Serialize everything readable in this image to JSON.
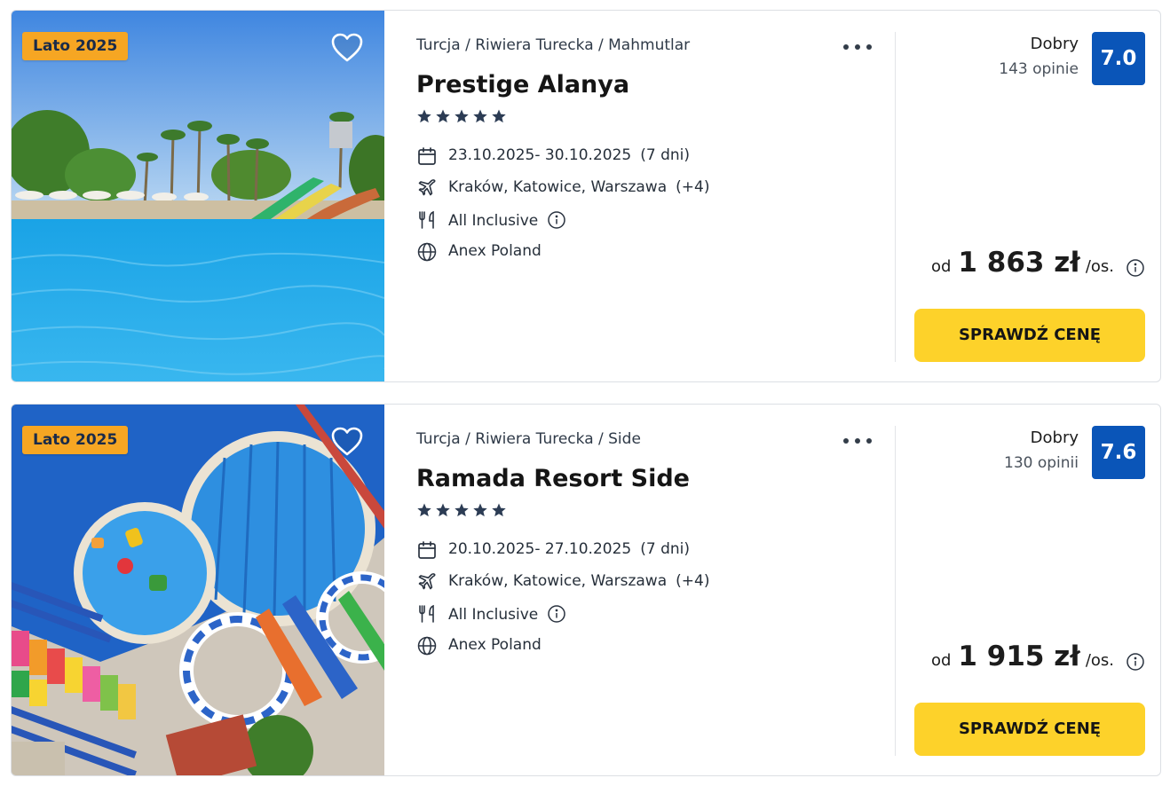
{
  "offers": [
    {
      "badge": "Lato 2025",
      "breadcrumb": "Turcja / Riwiera Turecka / Mahmutlar",
      "name": "Prestige Alanya",
      "stars": 5,
      "dates": "23.10.2025- 30.10.2025",
      "duration": "(7 dni)",
      "airports": "Kraków, Katowice, Warszawa",
      "airports_more": "(+4)",
      "board": "All Inclusive",
      "operator": "Anex Poland",
      "rating_label": "Dobry",
      "rating_count": "143 opinie",
      "rating_score": "7.0",
      "price_from": "od",
      "price": "1 863 zł",
      "price_unit": "/os.",
      "cta": "SPRAWDŹ CENĘ",
      "photo": "resort-pool-with-waterslides"
    },
    {
      "badge": "Lato 2025",
      "breadcrumb": "Turcja / Riwiera Turecka / Side",
      "name": "Ramada Resort Side",
      "stars": 5,
      "dates": "20.10.2025- 27.10.2025",
      "duration": "(7 dni)",
      "airports": "Kraków, Katowice, Warszawa",
      "airports_more": "(+4)",
      "board": "All Inclusive",
      "operator": "Anex Poland",
      "rating_label": "Dobry",
      "rating_count": "130 opinii",
      "rating_score": "7.6",
      "price_from": "od",
      "price": "1 915 zł",
      "price_unit": "/os.",
      "cta": "SPRAWDŹ CENĘ",
      "photo": "aerial-aquapark-pools"
    }
  ],
  "colors": {
    "badge": "#f6a623",
    "score": "#0a55b8",
    "cta": "#fdd22a",
    "star": "#2c3c54"
  },
  "icons": [
    "heart-icon",
    "more-dots-icon",
    "star-icon",
    "calendar-icon",
    "plane-icon",
    "cutlery-icon",
    "info-icon",
    "globe-icon"
  ]
}
